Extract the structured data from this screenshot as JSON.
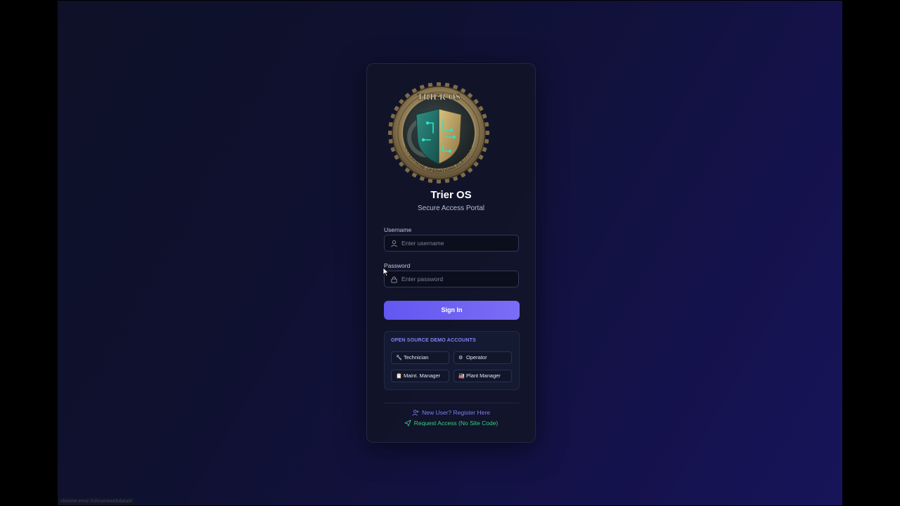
{
  "app": {
    "title": "Trier OS",
    "subtitle": "Secure Access Portal",
    "logo_text": "TRIER OS",
    "logo_ring_text": "ENTERPRISE OPERATIONS PLATFORM"
  },
  "form": {
    "username_label": "Username",
    "username_placeholder": "Enter username",
    "username_value": "",
    "password_label": "Password",
    "password_placeholder": "Enter password",
    "password_value": "",
    "signin_label": "Sign In"
  },
  "demo": {
    "heading": "OPEN SOURCE DEMO ACCOUNTS",
    "accounts": [
      {
        "label": "Technician",
        "icon": "wrench-icon",
        "glyph": "🔧"
      },
      {
        "label": "Operator",
        "icon": "gear-icon",
        "glyph": "⚙"
      },
      {
        "label": "Maint. Manager",
        "icon": "clipboard-icon",
        "glyph": "📋"
      },
      {
        "label": "Plant Manager",
        "icon": "factory-icon",
        "glyph": "🏭"
      }
    ]
  },
  "links": {
    "register": "New User? Register Here",
    "request_access": "Request Access (No Site Code)"
  },
  "status_bar": {
    "text": "chrome-error://chromewebdata/#"
  },
  "colors": {
    "accent": "#6a5ff2",
    "link_register": "#7c7ff0",
    "link_request": "#34d07a",
    "demo_heading": "#7f86f2"
  }
}
